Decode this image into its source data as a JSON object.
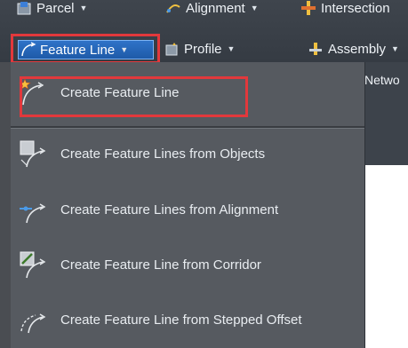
{
  "ribbon": {
    "parcel": "Parcel",
    "alignment": "Alignment",
    "intersection": "Intersection",
    "feature_line": "Feature Line",
    "profile": "Profile",
    "assembly": "Assembly",
    "network_partial": "Netwo"
  },
  "menu": {
    "items": [
      {
        "label": "Create Feature Line",
        "icon": "feature-line-star-icon"
      },
      {
        "label": "Create Feature Lines from Objects",
        "icon": "feature-line-from-objects-icon"
      },
      {
        "label": "Create Feature Lines from Alignment",
        "icon": "feature-line-from-alignment-icon"
      },
      {
        "label": "Create Feature Line from Corridor",
        "icon": "feature-line-from-corridor-icon"
      },
      {
        "label": "Create Feature Line from Stepped Offset",
        "icon": "feature-line-stepped-offset-icon"
      }
    ]
  },
  "colors": {
    "highlight_border": "#e2383c",
    "selected_button": "#1e5aa8",
    "menu_bg": "#565a60"
  }
}
